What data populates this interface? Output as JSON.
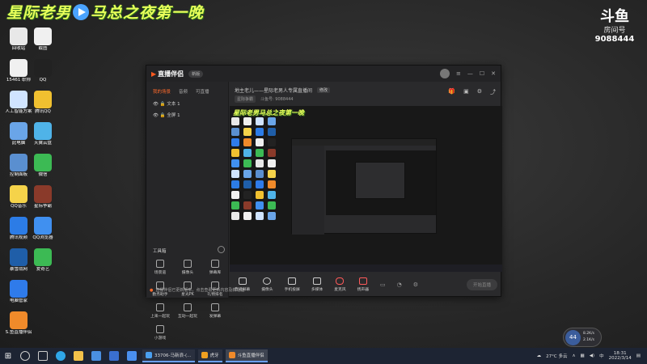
{
  "overlay": {
    "title_left": "星际老男",
    "title_right": "马总之夜第一晚",
    "brand": "斗鱼",
    "room_label": "房间号",
    "room_number": "9088444"
  },
  "desktop_icons": [
    {
      "label": "回收站",
      "color": "#e8e8e8"
    },
    {
      "label": "15461 职称",
      "color": "#f0f0f0"
    },
    {
      "label": "人工智能方案",
      "color": "#d0e4ff"
    },
    {
      "label": "此电脑",
      "color": "#6aa5e8"
    },
    {
      "label": "控制面板",
      "color": "#5a8fd0"
    },
    {
      "label": "QQ音乐",
      "color": "#f5d34a"
    },
    {
      "label": "腾讯视频",
      "color": "#2c7ce6"
    },
    {
      "label": "暴雪战网",
      "color": "#1f5ea8"
    },
    {
      "label": "电脑管家",
      "color": "#2f7bea"
    },
    {
      "label": "S.鱼直播伴侣",
      "color": "#f08a2a"
    },
    {
      "label": "截图",
      "color": "#f0f0f0"
    },
    {
      "label": "QQ",
      "color": "#222222"
    },
    {
      "label": "腾讯QQ",
      "color": "#f0c030"
    },
    {
      "label": "天翼云盘",
      "color": "#4fb3e8"
    },
    {
      "label": "微信",
      "color": "#3cba54"
    },
    {
      "label": "星际争霸",
      "color": "#8a3a2a"
    },
    {
      "label": "QQ浏览器",
      "color": "#4090f0"
    },
    {
      "label": "爱奇艺",
      "color": "#3cba54"
    }
  ],
  "window": {
    "app_name": "直播伴侣",
    "version": "新版",
    "left_tabs": [
      "我的场景",
      "音频",
      "可直播"
    ],
    "scenes": [
      "文本 1",
      "全屏 1"
    ],
    "toolbox_title": "工具箱",
    "tools": [
      "场景道",
      "摄像头",
      "弹幕库",
      "勤务助手",
      "星光PK",
      "礼物排名",
      "上来一起玩",
      "互动一起玩",
      "发弹幕",
      "小游戏"
    ],
    "room_title": "地主老儿——星际老男人专属直播间",
    "room_edit": "修改",
    "category_btn": "星际争霸",
    "room_meta": "斗鱼号: 9088444",
    "preview_title": "星际老男马总之夜第一晚",
    "bottom_items": [
      "直播屏幕",
      "摄像头",
      "手机投屏",
      "多媒体",
      "麦克风",
      "扬声器"
    ],
    "start_button": "开始直播",
    "notice": "直播伴侣已更新版本，点击查看更新内容及新功能"
  },
  "speed": {
    "percent": "44",
    "up": "8.2K/s",
    "down": "2.1K/s"
  },
  "taskbar": {
    "tasks": [
      "33706-马新浪-(…",
      "虎牙",
      "斗鱼直播伴侣"
    ],
    "weather": "27°C 多云",
    "time": "18:31",
    "date": "2022/3/14"
  },
  "colors": {
    "accent": "#ff6a2b",
    "title_yellow": "#e8ff5a"
  }
}
